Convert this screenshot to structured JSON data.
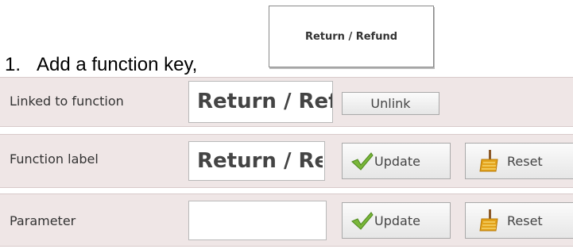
{
  "instruction": {
    "number": "1.",
    "text": "Add a function key,"
  },
  "function_key": {
    "label": "Return / Refund"
  },
  "rows": {
    "linked": {
      "label": "Linked to function",
      "value": "Return / Refund",
      "unlink_label": "Unlink"
    },
    "function_label": {
      "label": "Function label",
      "value": "Return / Refund",
      "update_label": "Update",
      "reset_label": "Reset"
    },
    "parameter": {
      "label": "Parameter",
      "value": "",
      "update_label": "Update",
      "reset_label": "Reset"
    }
  },
  "icons": {
    "update": "checkmark-icon",
    "reset": "broom-icon"
  },
  "colors": {
    "row_background": "#efe6e6",
    "checkmark": "#7ab63a",
    "broom": "#e2a21a"
  }
}
